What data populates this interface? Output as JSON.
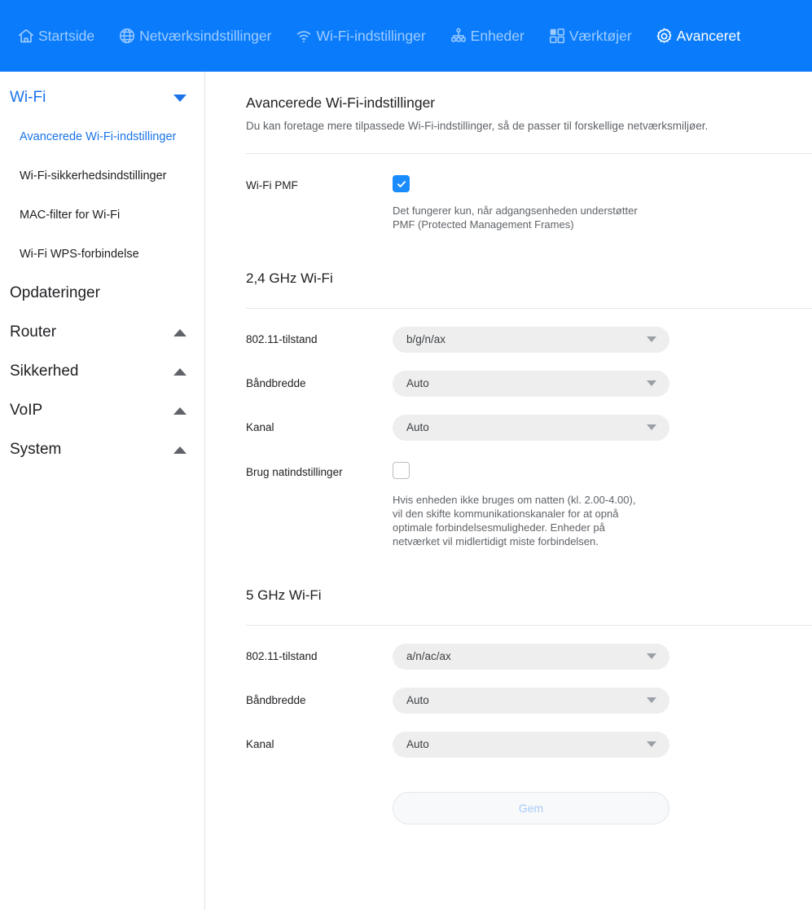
{
  "topnav": {
    "items": [
      {
        "label": "Startside",
        "icon": "home-icon",
        "active": false
      },
      {
        "label": "Netværksindstillinger",
        "icon": "globe-icon",
        "active": false
      },
      {
        "label": "Wi-Fi-indstillinger",
        "icon": "wifi-icon",
        "active": false
      },
      {
        "label": "Enheder",
        "icon": "devices-tree-icon",
        "active": false
      },
      {
        "label": "Værktøjer",
        "icon": "grid-tools-icon",
        "active": false
      },
      {
        "label": "Avanceret",
        "icon": "gear-icon",
        "active": true
      }
    ],
    "active_color": "#ffffff",
    "inactive_color": "#9ecbff",
    "background": "#0a7cfb"
  },
  "sidebar": {
    "groups": [
      {
        "label": "Wi-Fi",
        "chevron": "chevron-down-icon",
        "expanded": true,
        "accent": true
      },
      {
        "label": "Opdateringer",
        "chevron": "",
        "expanded": false,
        "accent": false
      },
      {
        "label": "Router",
        "chevron": "chevron-up-icon",
        "expanded": false,
        "accent": false
      },
      {
        "label": "Sikkerhed",
        "chevron": "chevron-up-icon",
        "expanded": false,
        "accent": false
      },
      {
        "label": "VoIP",
        "chevron": "chevron-up-icon",
        "expanded": false,
        "accent": false
      },
      {
        "label": "System",
        "chevron": "chevron-up-icon",
        "expanded": false,
        "accent": false
      }
    ],
    "wifi_subitems": [
      {
        "label": "Avancerede Wi-Fi-indstillinger",
        "active": true
      },
      {
        "label": "Wi-Fi-sikkerhedsindstillinger",
        "active": false
      },
      {
        "label": "MAC-filter for Wi-Fi",
        "active": false
      },
      {
        "label": "Wi-Fi WPS-forbindelse",
        "active": false
      }
    ],
    "accent_color": "#1a73e8"
  },
  "main": {
    "title": "Avancerede Wi-Fi-indstillinger",
    "subtitle": "Du kan foretage mere tilpassede Wi-Fi-indstillinger, så de passer til forskellige netværksmiljøer.",
    "pmf": {
      "label": "Wi-Fi PMF",
      "checked": true,
      "hint": "Det fungerer kun, når adgangsenheden understøtter\nPMF (Protected Management Frames)"
    },
    "band24": {
      "heading": "2,4 GHz Wi-Fi",
      "fields": [
        {
          "label": "802.11-tilstand",
          "value": "b/g/n/ax"
        },
        {
          "label": "Båndbredde",
          "value": "Auto"
        },
        {
          "label": "Kanal",
          "value": "Auto"
        }
      ],
      "night": {
        "label": "Brug natindstillinger",
        "checked": false,
        "hint": "Hvis enheden ikke bruges om natten (kl. 2.00-4.00),\nvil den skifte kommunikationskanaler for at opnå\noptimale forbindelsesmuligheder. Enheder på\nnetværket vil midlertidigt miste forbindelsen."
      }
    },
    "band5": {
      "heading": "5 GHz Wi-Fi",
      "fields": [
        {
          "label": "802.11-tilstand",
          "value": "a/n/ac/ax"
        },
        {
          "label": "Båndbredde",
          "value": "Auto"
        },
        {
          "label": "Kanal",
          "value": "Auto"
        }
      ]
    },
    "save_label": "Gem"
  }
}
